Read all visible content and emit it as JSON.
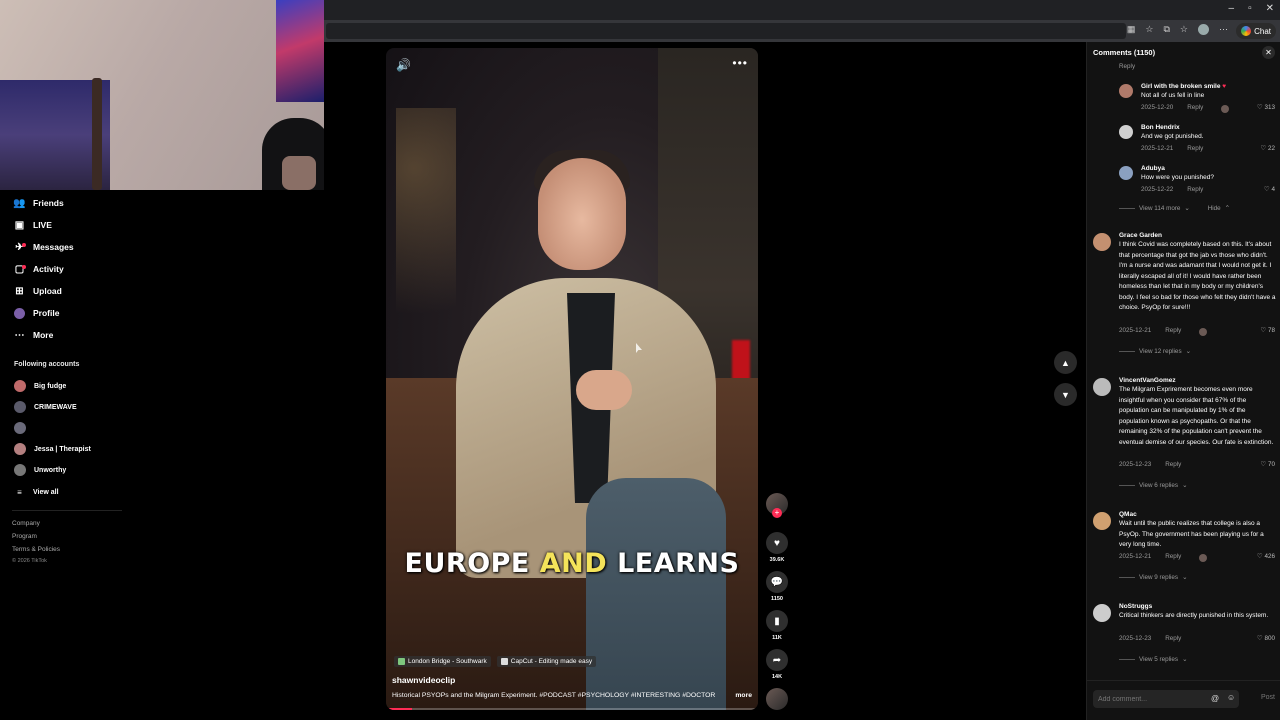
{
  "window": {
    "minimize": "–",
    "maximize": "▫",
    "close": "✕"
  },
  "toolbar": {
    "chat_label": "Chat"
  },
  "sidebar": {
    "nav": [
      {
        "label": "Friends",
        "icon": "friends-icon"
      },
      {
        "label": "LIVE",
        "icon": "live-icon"
      },
      {
        "label": "Messages",
        "icon": "messages-icon"
      },
      {
        "label": "Activity",
        "icon": "activity-icon"
      },
      {
        "label": "Upload",
        "icon": "upload-icon"
      },
      {
        "label": "Profile",
        "icon": "profile-icon"
      },
      {
        "label": "More",
        "icon": "more-icon"
      }
    ],
    "following_title": "Following accounts",
    "following": [
      {
        "name": "Big fudge",
        "color": "#c06a6a"
      },
      {
        "name": "CRIMEWAVE",
        "color": "#5a5a6a"
      },
      {
        "name": "",
        "color": "#6a6a7a"
      },
      {
        "name": "Jessa | Therapist",
        "color": "#b48080"
      },
      {
        "name": "Unworthy",
        "color": "#777777"
      }
    ],
    "view_all": "View all",
    "footer": [
      "Company",
      "Program",
      "Terms & Policies"
    ],
    "copyright": "© 2026 TikTok"
  },
  "video": {
    "caption_pre": "EUROPE ",
    "caption_hl": "AND",
    "caption_post": " LEARNS",
    "location_tag": "London Bridge - Southwark",
    "capcut_tag": "CapCut - Editing made easy",
    "author": "shawnvideoclip",
    "description": "Historical PSYOPs and the Milgram Experiment. #PODCAST #PSYCHOLOGY #INTERESTING #DOCTOR",
    "more_label": "more",
    "progress_percent": 7
  },
  "actions": {
    "likes": "39.6K",
    "comments": "1150",
    "saves": "11K",
    "shares": "14K"
  },
  "comments": {
    "header": "Comments (1150)",
    "items": [
      {
        "user": "Girl with the broken smile",
        "heart": "♥",
        "text": "Not all of us fell in line",
        "date": "2025-12-20",
        "reply": "Reply",
        "likes": "313",
        "author_liked": true,
        "color": "#b07a6a"
      },
      {
        "user": "Bon Hendrix",
        "text": "And we got punished.",
        "date": "2025-12-21",
        "reply": "Reply",
        "likes": "22",
        "color": "#d0d0d0"
      },
      {
        "user": "Adubya",
        "text": "How were you punished?",
        "date": "2025-12-22",
        "reply": "Reply",
        "likes": "4",
        "color": "#8aa0c0"
      },
      {
        "user": "Grace Garden",
        "text": "I think Covid was completely based on this. It's about that percentage that got the jab vs those who didn't. I'm a nurse and was adamant that I would not get it. I literally escaped all of it! I would have rather been homeless than let that in my body or my children's body. I feel so bad for those who felt they didn't have a choice. PsyOp for sure!!!",
        "date": "2025-12-21",
        "reply": "Reply",
        "likes": "78",
        "author_liked": true,
        "color": "#c49070"
      },
      {
        "user": "VincentVanGomez",
        "text": "The Milgram Exprirement becomes even more insightful when you consider that 67% of the population can be manipulated by 1% of the population known as psychopaths. Or that the remaining 32% of the population can't prevent the eventual demise of our species. Our fate is extinction.",
        "date": "2025-12-23",
        "reply": "Reply",
        "likes": "70",
        "color": "#bbbbbb"
      },
      {
        "user": "QMac",
        "text": "Wait until the public realizes that college is also a PsyOp. The government has been playing us for a very long time.",
        "date": "2025-12-21",
        "reply": "Reply",
        "likes": "426",
        "author_liked": true,
        "color": "#d0a070"
      },
      {
        "user": "NoStruggs",
        "text": "Critical thinkers are directly punished in this system.",
        "date": "2025-12-23",
        "reply": "Reply",
        "likes": "800",
        "color": "#cccccc"
      }
    ],
    "view_114": "View 114 more",
    "hide": "Hide",
    "view_12": "View 12 replies",
    "view_6": "View 6 replies",
    "view_9": "View 9 replies",
    "view_5": "View 5 replies",
    "top_partial_reply": "Reply",
    "input_placeholder": "Add comment...",
    "post_label": "Post"
  }
}
